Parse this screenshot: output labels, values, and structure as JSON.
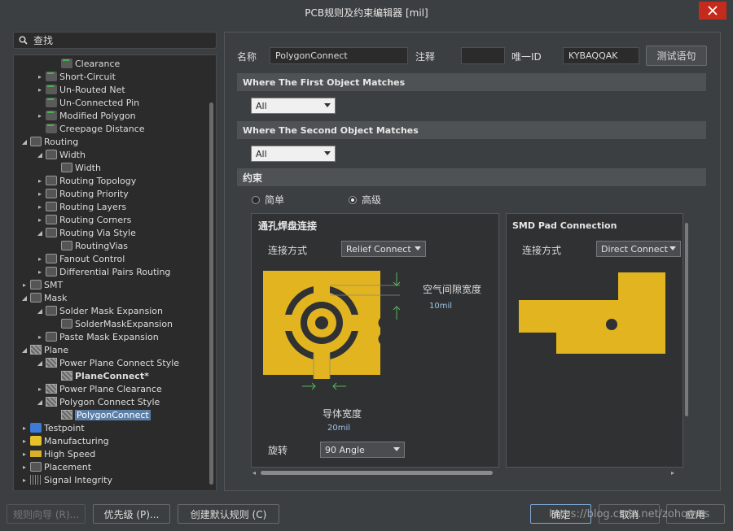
{
  "window": {
    "title": "PCB规则及约束编辑器 [mil]"
  },
  "search": {
    "label": "查找"
  },
  "tree": [
    {
      "label": "Clearance",
      "indent": 3,
      "arrow": "",
      "icon": "rule"
    },
    {
      "label": "Short-Circuit",
      "indent": 2,
      "arrow": "▸",
      "icon": "rule"
    },
    {
      "label": "Un-Routed Net",
      "indent": 2,
      "arrow": "▸",
      "icon": "rule"
    },
    {
      "label": "Un-Connected Pin",
      "indent": 2,
      "arrow": "",
      "icon": "rule"
    },
    {
      "label": "Modified Polygon",
      "indent": 2,
      "arrow": "▸",
      "icon": "rule"
    },
    {
      "label": "Creepage Distance",
      "indent": 2,
      "arrow": "",
      "icon": "rule"
    },
    {
      "label": "Routing",
      "indent": 1,
      "arrow": "◢",
      "icon": "cat"
    },
    {
      "label": "Width",
      "indent": 2,
      "arrow": "◢",
      "icon": "cat"
    },
    {
      "label": "Width",
      "indent": 3,
      "arrow": "",
      "icon": "cat"
    },
    {
      "label": "Routing Topology",
      "indent": 2,
      "arrow": "▸",
      "icon": "cat"
    },
    {
      "label": "Routing Priority",
      "indent": 2,
      "arrow": "▸",
      "icon": "cat"
    },
    {
      "label": "Routing Layers",
      "indent": 2,
      "arrow": "▸",
      "icon": "cat"
    },
    {
      "label": "Routing Corners",
      "indent": 2,
      "arrow": "▸",
      "icon": "cat"
    },
    {
      "label": "Routing Via Style",
      "indent": 2,
      "arrow": "◢",
      "icon": "cat"
    },
    {
      "label": "RoutingVias",
      "indent": 3,
      "arrow": "",
      "icon": "cat"
    },
    {
      "label": "Fanout Control",
      "indent": 2,
      "arrow": "▸",
      "icon": "cat"
    },
    {
      "label": "Differential Pairs Routing",
      "indent": 2,
      "arrow": "▸",
      "icon": "cat"
    },
    {
      "label": "SMT",
      "indent": 1,
      "arrow": "▸",
      "icon": "cat"
    },
    {
      "label": "Mask",
      "indent": 1,
      "arrow": "◢",
      "icon": "cat"
    },
    {
      "label": "Solder Mask Expansion",
      "indent": 2,
      "arrow": "◢",
      "icon": "cat"
    },
    {
      "label": "SolderMaskExpansion",
      "indent": 3,
      "arrow": "",
      "icon": "cat"
    },
    {
      "label": "Paste Mask Expansion",
      "indent": 2,
      "arrow": "▸",
      "icon": "cat"
    },
    {
      "label": "Plane",
      "indent": 1,
      "arrow": "◢",
      "icon": "plane"
    },
    {
      "label": "Power Plane Connect Style",
      "indent": 2,
      "arrow": "◢",
      "icon": "plane"
    },
    {
      "label": "PlaneConnect*",
      "indent": 3,
      "arrow": "",
      "icon": "plane",
      "bold": true
    },
    {
      "label": "Power Plane Clearance",
      "indent": 2,
      "arrow": "▸",
      "icon": "plane"
    },
    {
      "label": "Polygon Connect Style",
      "indent": 2,
      "arrow": "◢",
      "icon": "plane"
    },
    {
      "label": "PolygonConnect",
      "indent": 3,
      "arrow": "",
      "icon": "plane",
      "selected": true
    },
    {
      "label": "Testpoint",
      "indent": 1,
      "arrow": "▸",
      "icon": "tp"
    },
    {
      "label": "Manufacturing",
      "indent": 1,
      "arrow": "▸",
      "icon": "mf"
    },
    {
      "label": "High Speed",
      "indent": 1,
      "arrow": "▸",
      "icon": "hs"
    },
    {
      "label": "Placement",
      "indent": 1,
      "arrow": "▸",
      "icon": "cat"
    },
    {
      "label": "Signal Integrity",
      "indent": 1,
      "arrow": "▸",
      "icon": "si"
    }
  ],
  "rule": {
    "name_label": "名称",
    "name_value": "PolygonConnect",
    "comment_label": "注释",
    "comment_value": "",
    "uid_label": "唯一ID",
    "uid_value": "KYBAQQAK",
    "test_button": "测试语句"
  },
  "first_match": {
    "title": "Where The First Object Matches",
    "value": "All"
  },
  "second_match": {
    "title": "Where The Second Object Matches",
    "value": "All"
  },
  "constraints": {
    "title": "约束",
    "radio_simple": "简单",
    "radio_advanced": "高级",
    "selected_mode": "高级"
  },
  "via_panel": {
    "title": "通孔焊盘连接",
    "connect_label": "连接方式",
    "connect_value": "Relief Connect",
    "air_gap_label": "空气间隙宽度",
    "air_gap_value": "10mil",
    "conductor_label": "导体宽度",
    "conductor_value": "20mil",
    "rotate_label": "旋转",
    "rotate_value": "90 Angle"
  },
  "smd_panel": {
    "title": "SMD Pad Connection",
    "connect_label": "连接方式",
    "connect_value": "Direct Connect"
  },
  "colors": {
    "copper": "#e2b41f",
    "selection": "#5b7fa6"
  },
  "bottom": {
    "wizard": "规则向导 (R)...",
    "priority": "优先级 (P)...",
    "default_rules": "创建默认规则 (C)",
    "ok": "确定",
    "cancel": "取消",
    "apply": "应用"
  },
  "watermark": "https://blog.csdn.net/zohomas"
}
